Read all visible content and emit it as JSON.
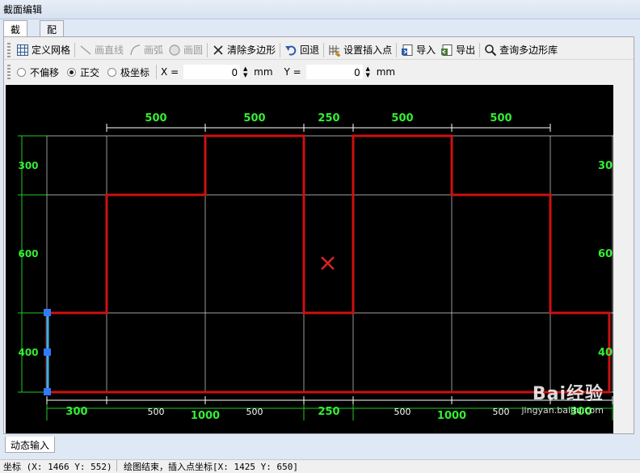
{
  "window": {
    "title": "截面编辑"
  },
  "tabs": [
    {
      "label": "截面",
      "active": true
    },
    {
      "label": "配筋",
      "active": false
    }
  ],
  "toolbar": {
    "define_grid": "定义网格",
    "draw_line": "画直线",
    "draw_arc": "画弧",
    "draw_circle": "画圆",
    "clear_polygon": "清除多边形",
    "undo": "回退",
    "set_insert_point": "设置插入点",
    "import": "导入",
    "export": "导出",
    "query_polygon_lib": "查询多边形库"
  },
  "options": {
    "no_offset": "不偏移",
    "orthogonal": "正交",
    "polar": "极坐标",
    "selected": "正交",
    "x_label": "X =",
    "x_value": "0",
    "x_unit": "mm",
    "y_label": "Y =",
    "y_value": "0",
    "y_unit": "mm"
  },
  "drawing": {
    "top_dims": [
      "500",
      "500",
      "250",
      "500",
      "500"
    ],
    "bottom_dims_inner": [
      "300",
      "500",
      "500",
      "250",
      "500",
      "500",
      "300"
    ],
    "bottom_dims_outer": [
      "1000",
      "1000"
    ],
    "left_dims": [
      "300",
      "600",
      "400"
    ],
    "right_dims": [
      "30",
      "60",
      "40"
    ],
    "colors": {
      "background": "#000000",
      "grid": "#ffffff",
      "polygon": "#cc1111",
      "dims": "#22dd22",
      "selected_edge": "#22bbee",
      "handle": "#3377ff"
    }
  },
  "bottom_tab": "动态输入",
  "status": {
    "coords": "坐标 (X: 1466 Y: 552)",
    "message": "绘图结束，插入点坐标[X: 1425 Y: 650]"
  },
  "watermark": {
    "logo": "Bai经验",
    "url": "jingyan.baidu.com"
  }
}
